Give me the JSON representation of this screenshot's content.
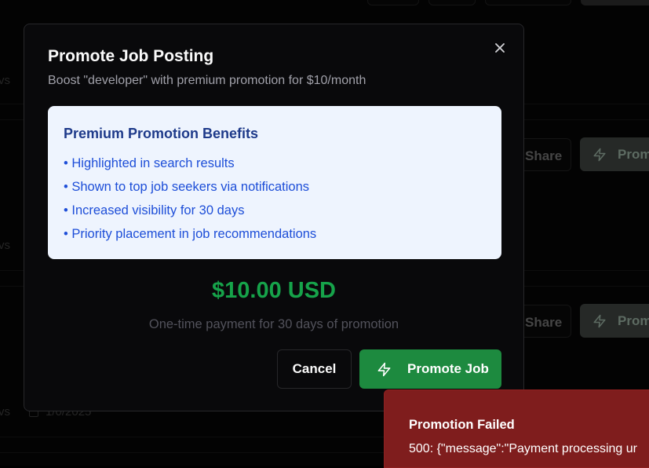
{
  "background": {
    "rows": [
      {
        "views_fragment": "vs",
        "share_label": "Share",
        "promote_label": "Prom"
      },
      {
        "views_fragment": "vs",
        "share_label": "Share",
        "promote_label": "Prom"
      },
      {
        "views_fragment": "vs",
        "date": "1/0/2025"
      }
    ],
    "top_views_fragment": "vs"
  },
  "modal": {
    "title": "Promote Job Posting",
    "subtitle": "Boost \"developer\" with premium promotion for $10/month",
    "close_icon": "close-icon",
    "benefits": {
      "title": "Premium Promotion Benefits",
      "items": [
        "• Highlighted in search results",
        "• Shown to top job seekers via notifications",
        "• Increased visibility for 30 days",
        "• Priority placement in job recommendations"
      ]
    },
    "price": "$10.00 USD",
    "price_note": "One-time payment for 30 days of promotion",
    "cancel_label": "Cancel",
    "promote_label": "Promote Job",
    "promote_icon": "lightning-icon"
  },
  "toast": {
    "title": "Promotion Failed",
    "message": "500: {\"message\":\"Payment processing ur"
  },
  "colors": {
    "accent_green": "#16a34a",
    "button_green": "#1d8a3f",
    "benefit_text": "#1d4ed8",
    "toast_bg": "#7f1d1d"
  }
}
